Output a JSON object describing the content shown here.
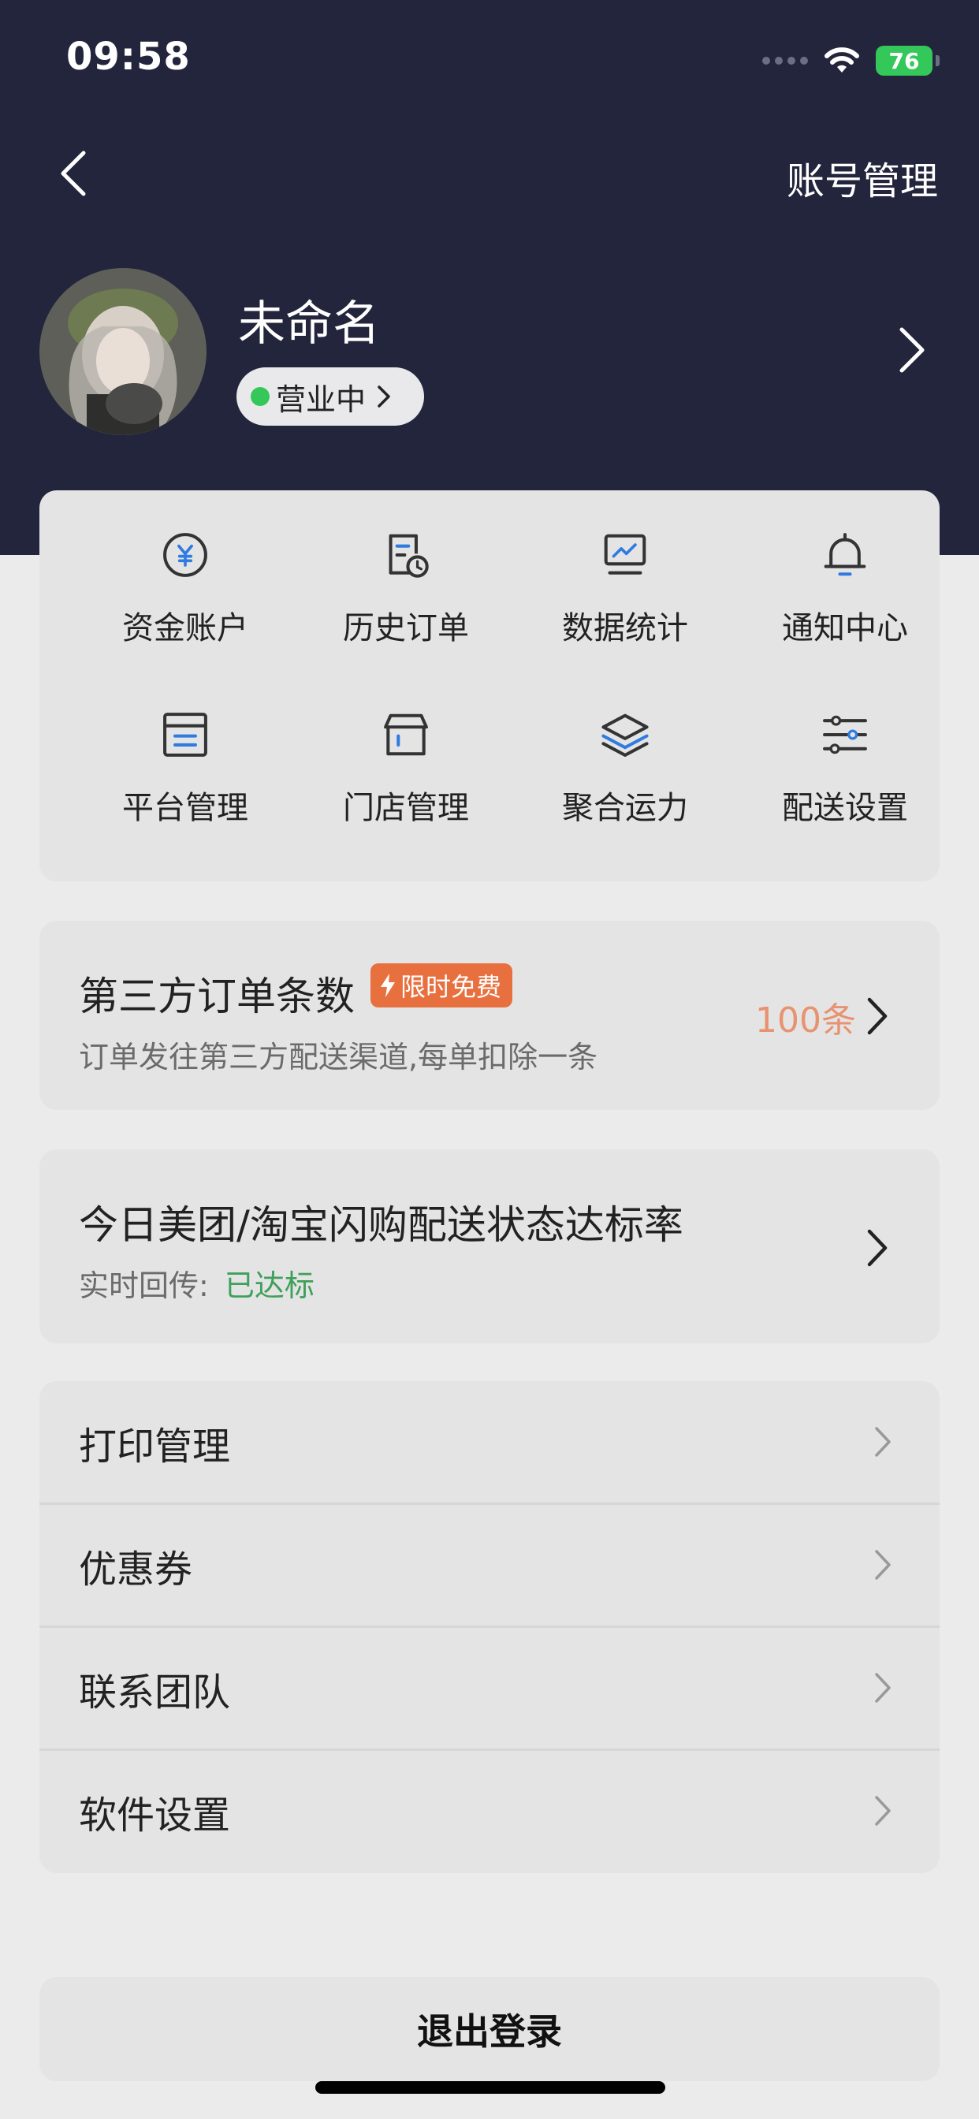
{
  "status_bar": {
    "time": "09:58",
    "battery": "76"
  },
  "nav": {
    "title_right": "账号管理"
  },
  "profile": {
    "name": "未命名",
    "status": "营业中"
  },
  "grid": [
    {
      "label": "资金账户",
      "icon": "yuan-circle-icon"
    },
    {
      "label": "历史订单",
      "icon": "order-history-icon"
    },
    {
      "label": "数据统计",
      "icon": "chart-monitor-icon"
    },
    {
      "label": "通知中心",
      "icon": "bell-icon"
    },
    {
      "label": "平台管理",
      "icon": "platform-icon"
    },
    {
      "label": "门店管理",
      "icon": "store-icon"
    },
    {
      "label": "聚合运力",
      "icon": "layers-icon"
    },
    {
      "label": "配送设置",
      "icon": "sliders-icon"
    }
  ],
  "third_party": {
    "title": "第三方订单条数",
    "badge": "限时免费",
    "subtitle": "订单发往第三方配送渠道,每单扣除一条",
    "count": "100条"
  },
  "delivery_rate": {
    "title": "今日美团/淘宝闪购配送状态达标率",
    "label": "实时回传:",
    "status": "已达标"
  },
  "menu": [
    {
      "label": "打印管理"
    },
    {
      "label": "优惠券"
    },
    {
      "label": "联系团队"
    },
    {
      "label": "软件设置"
    }
  ],
  "logout": "退出登录",
  "colors": {
    "header": "#22253c",
    "accent_blue": "#2f7be0",
    "status_green": "#34c759",
    "badge_orange": "#e8703f",
    "count_orange": "#e79270",
    "ok_green": "#3fa05a"
  }
}
